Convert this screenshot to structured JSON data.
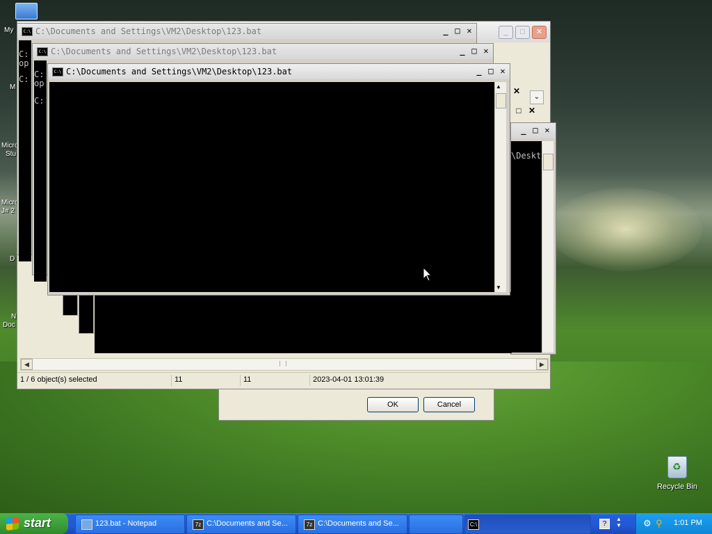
{
  "desktop": {
    "partial_icon_labels": [
      "My",
      "C",
      "M",
      "Micro",
      "Stu",
      "Micro",
      "J# 2",
      "D",
      "N",
      "Doc"
    ],
    "recycle_bin_label": "Recycle Bin"
  },
  "explorer": {
    "status": {
      "selection": "1 / 6 object(s) selected",
      "size": "11",
      "packed": "11",
      "modified": "2023-04-01 13:01:39"
    },
    "min": "_",
    "max": "□",
    "close": "✕"
  },
  "cmd_windows": [
    {
      "title": "C:\\Documents and Settings\\VM2\\Desktop\\123.bat",
      "lines": [
        "C:",
        "op",
        "",
        "C:"
      ]
    },
    {
      "title": "C:\\Documents and Settings\\VM2\\Desktop\\123.bat",
      "lines": [
        "C:",
        "op",
        "",
        "C:"
      ]
    },
    {
      "title": "C:\\Documents and Settings\\VM2\\Desktop\\123.bat",
      "lines": []
    }
  ],
  "cmd_back": {
    "visible_text": "\\Deskt"
  },
  "window_buttons": {
    "min": "_",
    "max": "□",
    "close": "✕"
  },
  "dialog": {
    "ok": "OK",
    "cancel": "Cancel"
  },
  "taskbar": {
    "start_label": "start",
    "tasks": [
      {
        "label": "123.bat - Notepad",
        "icon": "notepad-icon"
      },
      {
        "label": "C:\\Documents and Se...",
        "icon": "7zip-icon"
      },
      {
        "label": "C:\\Documents and Se...",
        "icon": "7zip-icon"
      },
      {
        "label": "",
        "icon": "blank"
      },
      {
        "label": "",
        "icon": "cmd-icon"
      }
    ],
    "clock": "1:01 PM"
  }
}
